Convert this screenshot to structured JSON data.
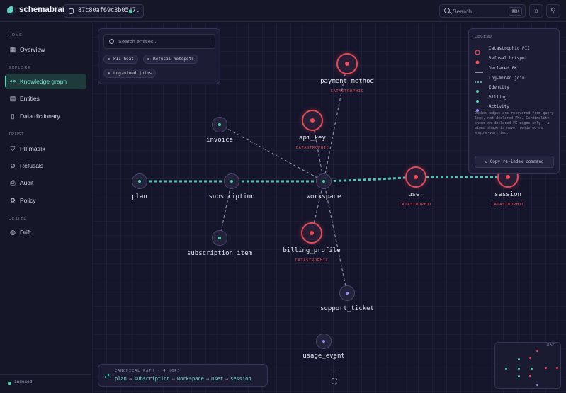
{
  "app": {
    "brand": "schemabrain",
    "connection_hash": "87c80af69c3b0547",
    "search_placeholder": "Search...",
    "search_shortcut": "⌘K"
  },
  "sidebar": {
    "sections": [
      {
        "title": "HOME",
        "items": [
          {
            "label": "Overview",
            "icon": "grid-icon",
            "active": false
          }
        ]
      },
      {
        "title": "EXPLORE",
        "items": [
          {
            "label": "Knowledge graph",
            "icon": "graph-icon",
            "active": true
          },
          {
            "label": "Entities",
            "icon": "table-icon",
            "active": false
          },
          {
            "label": "Data dictionary",
            "icon": "book-icon",
            "active": false
          }
        ]
      },
      {
        "title": "TRUST",
        "items": [
          {
            "label": "PII matrix",
            "icon": "shield-icon",
            "active": false
          },
          {
            "label": "Refusals",
            "icon": "ban-icon",
            "active": false
          },
          {
            "label": "Audit",
            "icon": "audit-icon",
            "active": false
          },
          {
            "label": "Policy",
            "icon": "gear-icon",
            "active": false
          }
        ]
      },
      {
        "title": "HEALTH",
        "items": [
          {
            "label": "Drift",
            "icon": "drift-icon",
            "active": false
          }
        ]
      }
    ],
    "status": "indexed"
  },
  "entity_search": {
    "placeholder": "Search entities...",
    "chips": [
      "PII heat",
      "Refusal hotspots",
      "Log-mined joins"
    ]
  },
  "graph": {
    "nodes": [
      {
        "id": "payment_method",
        "tag": "CATASTROPHIC",
        "kind": "catastrophic"
      },
      {
        "id": "api_key",
        "tag": "CATASTROPHIC",
        "kind": "catastrophic"
      },
      {
        "id": "invoice",
        "tag": "",
        "kind": "identity"
      },
      {
        "id": "plan",
        "tag": "",
        "kind": "identity"
      },
      {
        "id": "subscription",
        "tag": "",
        "kind": "identity"
      },
      {
        "id": "workspace",
        "tag": "",
        "kind": "identity"
      },
      {
        "id": "user",
        "tag": "CATASTROPHIC",
        "kind": "catastrophic"
      },
      {
        "id": "session",
        "tag": "CATASTROPHIC",
        "kind": "catastrophic"
      },
      {
        "id": "subscription_item",
        "tag": "",
        "kind": "identity"
      },
      {
        "id": "billing_profile",
        "tag": "CATASTROPHIC",
        "kind": "catastrophic"
      },
      {
        "id": "support_ticket",
        "tag": "",
        "kind": "activity"
      },
      {
        "id": "usage_event",
        "tag": "",
        "kind": "activity"
      }
    ]
  },
  "legend": {
    "title": "LEGEND",
    "items": [
      {
        "label": "Catastrophic PII",
        "swatch": "ring"
      },
      {
        "label": "Refusal hotspot",
        "swatch": "dot-red"
      },
      {
        "label": "Declared FK",
        "swatch": "line"
      },
      {
        "label": "Log-mined join",
        "swatch": "dash"
      },
      {
        "label": "Identity",
        "swatch": "dot-teal"
      },
      {
        "label": "Billing",
        "swatch": "dot-teal2"
      },
      {
        "label": "Activity",
        "swatch": "dot-purple"
      }
    ],
    "note": "Dashed edges are recovered from query logs, not declared FKs. Cardinality shows on declared FK edges only — a mined shape is never rendered as engine-verified.",
    "button": "Copy re-index command"
  },
  "canonical_path": {
    "title": "CANONICAL PATH · 4 HOPS",
    "steps": [
      "plan",
      "subscription",
      "workspace",
      "user",
      "session"
    ]
  },
  "zoom": {
    "in": "+",
    "out": "−",
    "fit": "⛶"
  },
  "minimap": {
    "title": "MAP"
  },
  "colors": {
    "accent": "#5fd3c4",
    "danger": "#e04b5a",
    "activity": "#9a8ff0"
  }
}
